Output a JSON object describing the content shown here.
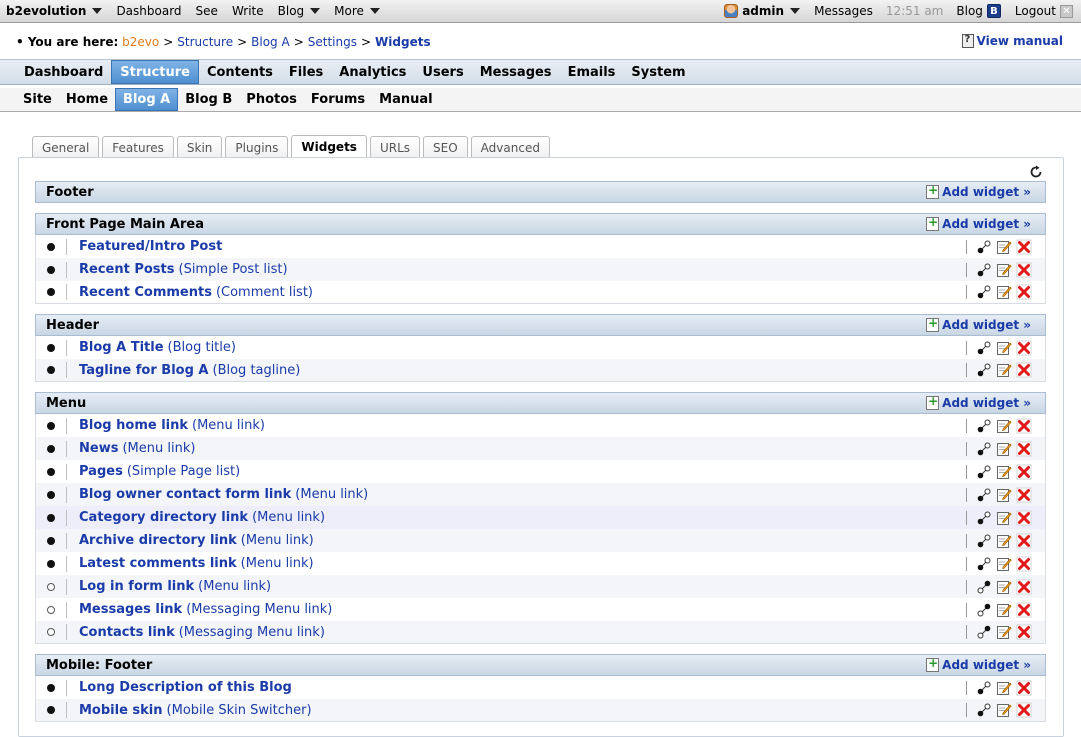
{
  "evobar": {
    "brand": "b2evolution",
    "left_items": [
      "Dashboard",
      "See",
      "Write",
      "Blog",
      "More"
    ],
    "user": "admin",
    "messages": "Messages",
    "time": "12:51 am",
    "blog": "Blog",
    "logout": "Logout"
  },
  "breadcrumb": {
    "label": "• You are here:",
    "items": [
      "b2evo",
      "Structure",
      "Blog A",
      "Settings"
    ],
    "current": "Widgets",
    "view_manual": "View manual"
  },
  "main_menu": [
    "Dashboard",
    "Structure",
    "Contents",
    "Files",
    "Analytics",
    "Users",
    "Messages",
    "Emails",
    "System"
  ],
  "sub_menu": [
    "Site",
    "Home",
    "Blog A",
    "Blog B",
    "Photos",
    "Forums",
    "Manual"
  ],
  "tabs": [
    "General",
    "Features",
    "Skin",
    "Plugins",
    "Widgets",
    "URLs",
    "SEO",
    "Advanced"
  ],
  "add_widget_label": "Add widget »",
  "containers": [
    {
      "title": "Footer",
      "widgets": []
    },
    {
      "title": "Front Page Main Area",
      "widgets": [
        {
          "name": "Featured/Intro Post",
          "type": "",
          "enabled": true
        },
        {
          "name": "Recent Posts",
          "type": "(Simple Post list)",
          "enabled": true
        },
        {
          "name": "Recent Comments",
          "type": "(Comment list)",
          "enabled": true
        }
      ]
    },
    {
      "title": "Header",
      "widgets": [
        {
          "name": "Blog A Title",
          "type": "(Blog title)",
          "enabled": true
        },
        {
          "name": "Tagline for Blog A",
          "type": "(Blog tagline)",
          "enabled": true
        }
      ]
    },
    {
      "title": "Menu",
      "widgets": [
        {
          "name": "Blog home link",
          "type": "(Menu link)",
          "enabled": true
        },
        {
          "name": "News",
          "type": "(Menu link)",
          "enabled": true
        },
        {
          "name": "Pages",
          "type": "(Simple Page list)",
          "enabled": true
        },
        {
          "name": "Blog owner contact form link",
          "type": "(Menu link)",
          "enabled": true
        },
        {
          "name": "Category directory link",
          "type": "(Menu link)",
          "enabled": true
        },
        {
          "name": "Archive directory link",
          "type": "(Menu link)",
          "enabled": true
        },
        {
          "name": "Latest comments link",
          "type": "(Menu link)",
          "enabled": true
        },
        {
          "name": "Log in form link",
          "type": "(Menu link)",
          "enabled": false
        },
        {
          "name": "Messages link",
          "type": "(Messaging Menu link)",
          "enabled": false
        },
        {
          "name": "Contacts link",
          "type": "(Messaging Menu link)",
          "enabled": false
        }
      ]
    },
    {
      "title": "Mobile: Footer",
      "widgets": [
        {
          "name": "Long Description of this Blog",
          "type": "",
          "enabled": true
        },
        {
          "name": "Mobile skin",
          "type": "(Mobile Skin Switcher)",
          "enabled": true
        }
      ]
    }
  ]
}
